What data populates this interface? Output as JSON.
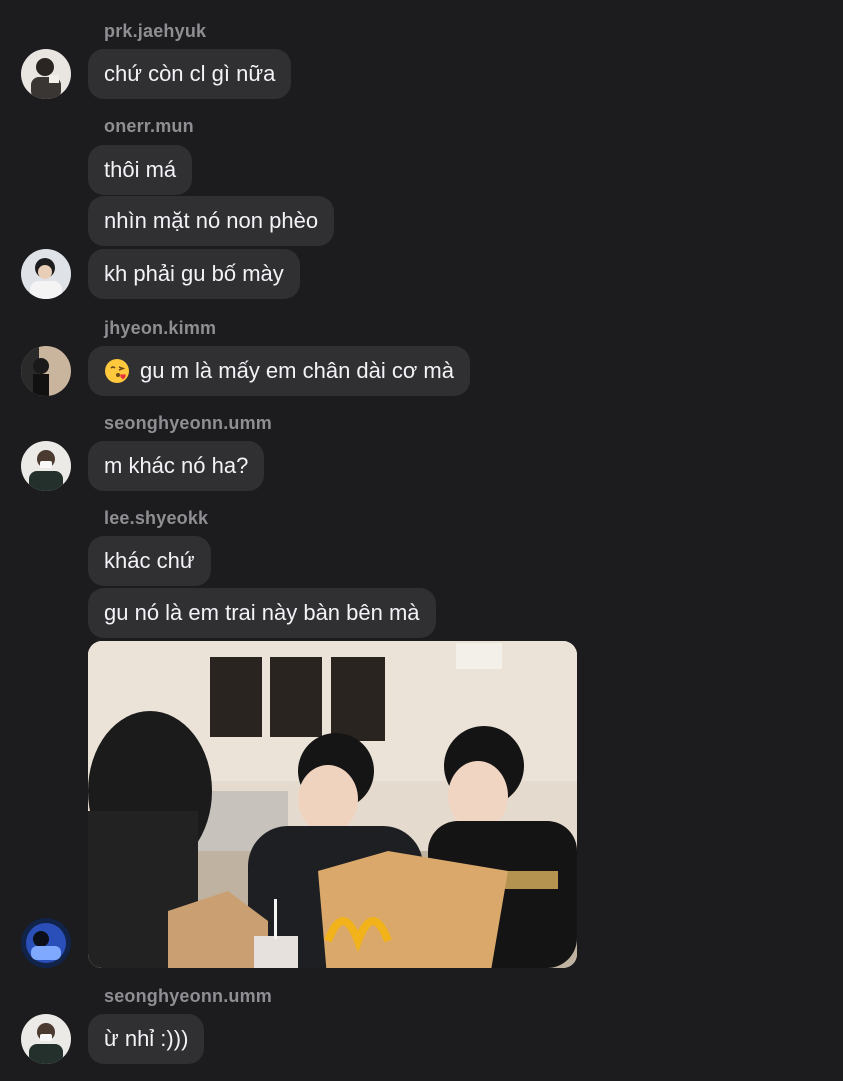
{
  "messages": [
    {
      "username": "prk.jaehyuk",
      "bubbles": [
        "chứ còn cl gì nữa"
      ]
    },
    {
      "username": "onerr.mun",
      "bubbles": [
        "thôi má",
        "nhìn mặt nó non phèo",
        "kh phải gu bố mày"
      ]
    },
    {
      "username": "jhyeon.kimm",
      "bubbles": [
        "gu m là mấy em chân dài cơ mà"
      ],
      "emoji": "face-blowing-kiss-icon"
    },
    {
      "username": "seonghyeonn.umm",
      "bubbles": [
        "m khác nó ha?"
      ]
    },
    {
      "username": "lee.shyeokk",
      "bubbles": [
        "khác chứ",
        "gu nó là em trai này bàn bên mà"
      ],
      "attachment": "photo"
    },
    {
      "username": "seonghyeonn.umm",
      "bubbles": [
        "ừ nhỉ :)))"
      ]
    }
  ],
  "colors": {
    "background": "#1c1c1e",
    "bubble": "#303033",
    "username": "#8e8e93",
    "text": "#f2f2f7"
  }
}
